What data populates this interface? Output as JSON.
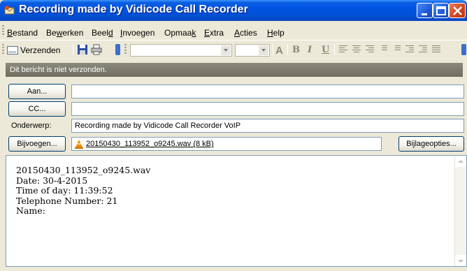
{
  "window": {
    "title": "Recording made by Vidicode Call Recorder"
  },
  "menu": {
    "items": [
      {
        "label": "Bestand",
        "key": "B"
      },
      {
        "label": "Bewerken",
        "key": "w"
      },
      {
        "label": "Beeld",
        "key": "d"
      },
      {
        "label": "Invoegen",
        "key": "I"
      },
      {
        "label": "Opmaak",
        "key": "k"
      },
      {
        "label": "Extra",
        "key": "E"
      },
      {
        "label": "Acties",
        "key": "A"
      },
      {
        "label": "Help",
        "key": "H"
      }
    ]
  },
  "toolbar": {
    "send_label": "Verzenden",
    "font_value": "",
    "size_value": ""
  },
  "infobar": {
    "text": "Dit bericht is niet verzonden."
  },
  "header": {
    "to_button": "Aan...",
    "to_value": "",
    "cc_button": "CC...",
    "cc_value": "",
    "subject_label": "Onderwerp:",
    "subject_value": "Recording made by Vidicode Call Recorder VoIP",
    "attach_button": "Bijvoegen...",
    "attachment_name": "20150430_113952_o9245.wav (8 kB)",
    "attach_options_button": "Bijlageopties..."
  },
  "body": {
    "lines": [
      "20150430_113952_o9245.wav",
      "Date: 30-4-2015",
      "Time of day: 11:39:52",
      "Telephone Number: 21",
      "Name:"
    ]
  },
  "colors": {
    "titlebar": "#0054e3",
    "chrome": "#ece9d8",
    "field_border": "#7f9db9"
  }
}
